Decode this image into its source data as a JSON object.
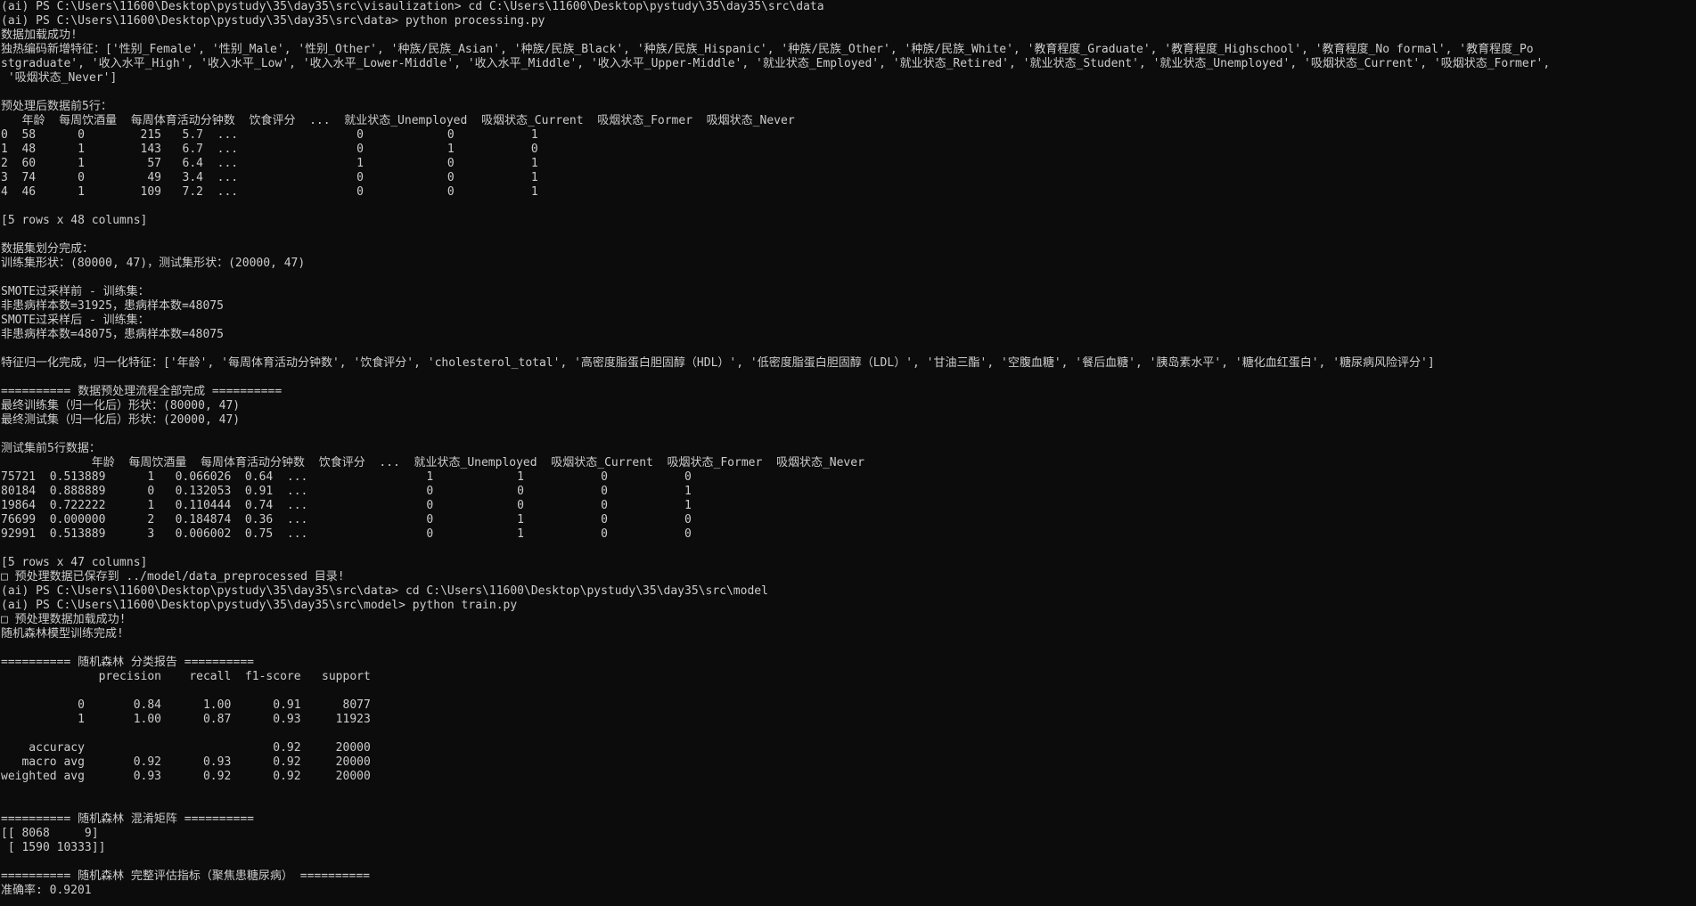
{
  "terminal": {
    "lines": [
      "(ai) PS C:\\Users\\11600\\Desktop\\pystudy\\35\\day35\\src\\visaulization> cd C:\\Users\\11600\\Desktop\\pystudy\\35\\day35\\src\\data",
      "(ai) PS C:\\Users\\11600\\Desktop\\pystudy\\35\\day35\\src\\data> python processing.py",
      "数据加载成功!",
      "独热编码新增特征：['性别_Female', '性别_Male', '性别_Other', '种族/民族_Asian', '种族/民族_Black', '种族/民族_Hispanic', '种族/民族_Other', '种族/民族_White', '教育程度_Graduate', '教育程度_Highschool', '教育程度_No formal', '教育程度_Po",
      "stgraduate', '收入水平_High', '收入水平_Low', '收入水平_Lower-Middle', '收入水平_Middle', '收入水平_Upper-Middle', '就业状态_Employed', '就业状态_Retired', '就业状态_Student', '就业状态_Unemployed', '吸烟状态_Current', '吸烟状态_Former',",
      " '吸烟状态_Never']",
      "",
      "预处理后数据前5行：",
      "   年龄  每周饮酒量  每周体育活动分钟数  饮食评分  ...  就业状态_Unemployed  吸烟状态_Current  吸烟状态_Former  吸烟状态_Never",
      "0  58      0        215   5.7  ...                 0            0           1",
      "1  48      1        143   6.7  ...                 0            1           0",
      "2  60      1         57   6.4  ...                 1            0           1",
      "3  74      0         49   3.4  ...                 0            0           1",
      "4  46      1        109   7.2  ...                 0            0           1",
      "",
      "[5 rows x 48 columns]",
      "",
      "数据集划分完成：",
      "训练集形状：(80000, 47)，测试集形状：(20000, 47)",
      "",
      "SMOTE过采样前 - 训练集：",
      "非患病样本数=31925，患病样本数=48075",
      "SMOTE过采样后 - 训练集：",
      "非患病样本数=48075，患病样本数=48075",
      "",
      "特征归一化完成，归一化特征：['年龄', '每周体育活动分钟数', '饮食评分', 'cholesterol_total', '高密度脂蛋白胆固醇（HDL）', '低密度脂蛋白胆固醇（LDL）', '甘油三酯', '空腹血糖', '餐后血糖', '胰岛素水平', '糖化血红蛋白', '糖尿病风险评分']",
      "",
      "========== 数据预处理流程全部完成 ==========",
      "最终训练集（归一化后）形状：(80000, 47)",
      "最终测试集（归一化后）形状：(20000, 47)",
      "",
      "测试集前5行数据：",
      "             年龄  每周饮酒量  每周体育活动分钟数  饮食评分  ...  就业状态_Unemployed  吸烟状态_Current  吸烟状态_Former  吸烟状态_Never",
      "75721  0.513889      1   0.066026  0.64  ...                 1            1           0           0",
      "80184  0.888889      0   0.132053  0.91  ...                 0            0           0           1",
      "19864  0.722222      1   0.110444  0.74  ...                 0            0           0           1",
      "76699  0.000000      2   0.184874  0.36  ...                 0            1           0           0",
      "92991  0.513889      3   0.006002  0.75  ...                 0            1           0           0",
      "",
      "[5 rows x 47 columns]",
      "□ 预处理数据已保存到 ../model/data_preprocessed 目录!",
      "(ai) PS C:\\Users\\11600\\Desktop\\pystudy\\35\\day35\\src\\data> cd C:\\Users\\11600\\Desktop\\pystudy\\35\\day35\\src\\model",
      "(ai) PS C:\\Users\\11600\\Desktop\\pystudy\\35\\day35\\src\\model> python train.py",
      "□ 预处理数据加载成功!",
      "随机森林模型训练完成!",
      "",
      "========== 随机森林 分类报告 ==========",
      "              precision    recall  f1-score   support",
      "",
      "           0       0.84      1.00      0.91      8077",
      "           1       1.00      0.87      0.93     11923",
      "",
      "    accuracy                           0.92     20000",
      "   macro avg       0.92      0.93      0.92     20000",
      "weighted avg       0.93      0.92      0.92     20000",
      "",
      "",
      "========== 随机森林 混淆矩阵 ==========",
      "[[ 8068     9]",
      " [ 1590 10333]]",
      "",
      "========== 随机森林 完整评估指标（聚焦患糖尿病） ==========",
      "准确率: 0.9201"
    ]
  }
}
